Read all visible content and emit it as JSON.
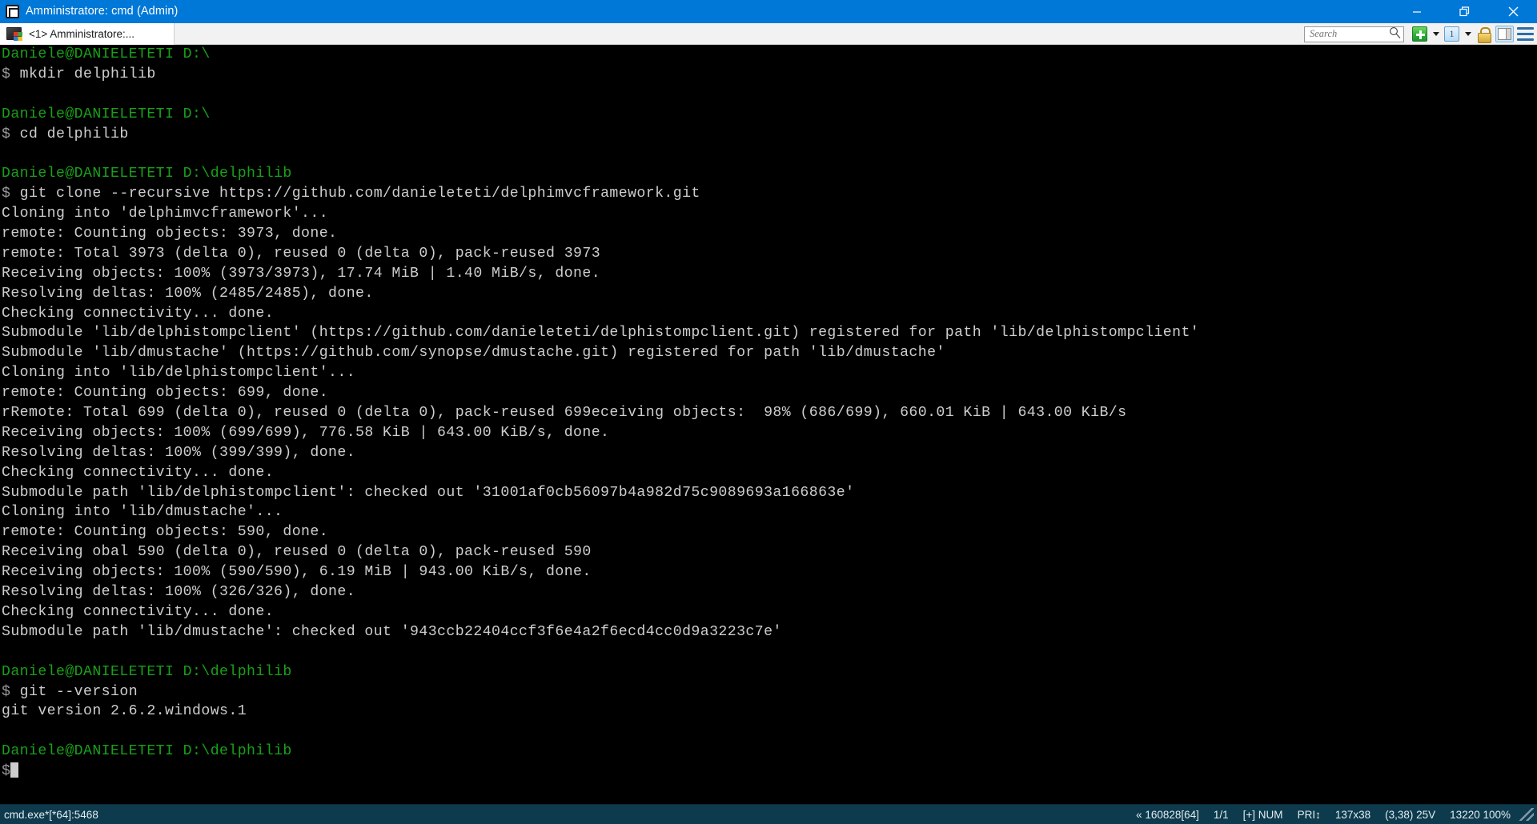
{
  "window": {
    "title": "Amministratore: cmd (Admin)",
    "icon": "console-window-icon",
    "minimize_label": "Minimize",
    "restore_label": "Restore",
    "close_label": "Close"
  },
  "tabbar": {
    "tabs": [
      {
        "label": "<1> Amministratore:...",
        "icon": "console-tab-icon",
        "active": true
      }
    ]
  },
  "toolbar": {
    "search": {
      "placeholder": "Search",
      "value": ""
    },
    "search_icon": "magnifier-icon",
    "new_console_label": "New console",
    "new_console_icon": "green-plus-icon",
    "new_console_caret": "chevron-down-icon",
    "switch_console_label": "Switch console",
    "switch_console_icon": "console-1-icon",
    "switch_console_caret": "chevron-down-icon",
    "lock_label": "Lock",
    "lock_icon": "padlock-icon",
    "panes_label": "Toggle panes",
    "panes_icon": "split-panes-icon",
    "menu_label": "Menu",
    "menu_icon": "hamburger-menu-icon"
  },
  "colors": {
    "titlebar": "#0078d7",
    "prompt_green": "#18a018",
    "dollar_gray": "#9a9a9a",
    "output_gray": "#cdcdcd",
    "terminal_bg": "#000000",
    "statusbar_bg": "#0e3a4d"
  },
  "terminal": {
    "lines": [
      {
        "segments": [
          {
            "text": "Daniele@DANIELETETI D:\\",
            "color": "green"
          }
        ]
      },
      {
        "segments": [
          {
            "text": "$",
            "color": "dim"
          },
          {
            "text": " mkdir delphilib",
            "color": "white"
          }
        ]
      },
      {
        "segments": [
          {
            "text": "",
            "color": "white"
          }
        ]
      },
      {
        "segments": [
          {
            "text": "Daniele@DANIELETETI D:\\",
            "color": "green"
          }
        ]
      },
      {
        "segments": [
          {
            "text": "$",
            "color": "dim"
          },
          {
            "text": " cd delphilib",
            "color": "white"
          }
        ]
      },
      {
        "segments": [
          {
            "text": "",
            "color": "white"
          }
        ]
      },
      {
        "segments": [
          {
            "text": "Daniele@DANIELETETI D:\\delphilib",
            "color": "green"
          }
        ]
      },
      {
        "segments": [
          {
            "text": "$",
            "color": "dim"
          },
          {
            "text": " git clone --recursive https://github.com/danieleteti/delphimvcframework.git",
            "color": "white"
          }
        ]
      },
      {
        "segments": [
          {
            "text": "Cloning into 'delphimvcframework'...",
            "color": "white"
          }
        ]
      },
      {
        "segments": [
          {
            "text": "remote: Counting objects: 3973, done.",
            "color": "white"
          }
        ]
      },
      {
        "segments": [
          {
            "text": "remote: Total 3973 (delta 0), reused 0 (delta 0), pack-reused 3973",
            "color": "white"
          }
        ]
      },
      {
        "segments": [
          {
            "text": "Receiving objects: 100% (3973/3973), 17.74 MiB | 1.40 MiB/s, done.",
            "color": "white"
          }
        ]
      },
      {
        "segments": [
          {
            "text": "Resolving deltas: 100% (2485/2485), done.",
            "color": "white"
          }
        ]
      },
      {
        "segments": [
          {
            "text": "Checking connectivity... done.",
            "color": "white"
          }
        ]
      },
      {
        "segments": [
          {
            "text": "Submodule 'lib/delphistompclient' (https://github.com/danieleteti/delphistompclient.git) registered for path 'lib/delphistompclient'",
            "color": "white"
          }
        ]
      },
      {
        "segments": [
          {
            "text": "Submodule 'lib/dmustache' (https://github.com/synopse/dmustache.git) registered for path 'lib/dmustache'",
            "color": "white"
          }
        ]
      },
      {
        "segments": [
          {
            "text": "Cloning into 'lib/delphistompclient'...",
            "color": "white"
          }
        ]
      },
      {
        "segments": [
          {
            "text": "remote: Counting objects: 699, done.",
            "color": "white"
          }
        ]
      },
      {
        "segments": [
          {
            "text": "rRemote: Total 699 (delta 0), reused 0 (delta 0), pack-reused 699eceiving objects:  98% (686/699), 660.01 KiB | 643.00 KiB/s",
            "color": "white"
          }
        ]
      },
      {
        "segments": [
          {
            "text": "Receiving objects: 100% (699/699), 776.58 KiB | 643.00 KiB/s, done.",
            "color": "white"
          }
        ]
      },
      {
        "segments": [
          {
            "text": "Resolving deltas: 100% (399/399), done.",
            "color": "white"
          }
        ]
      },
      {
        "segments": [
          {
            "text": "Checking connectivity... done.",
            "color": "white"
          }
        ]
      },
      {
        "segments": [
          {
            "text": "Submodule path 'lib/delphistompclient': checked out '31001af0cb56097b4a982d75c9089693a166863e'",
            "color": "white"
          }
        ]
      },
      {
        "segments": [
          {
            "text": "Cloning into 'lib/dmustache'...",
            "color": "white"
          }
        ]
      },
      {
        "segments": [
          {
            "text": "remote: Counting objects: 590, done.",
            "color": "white"
          }
        ]
      },
      {
        "segments": [
          {
            "text": "Receiving obal 590 (delta 0), reused 0 (delta 0), pack-reused 590",
            "color": "white"
          }
        ]
      },
      {
        "segments": [
          {
            "text": "Receiving objects: 100% (590/590), 6.19 MiB | 943.00 KiB/s, done.",
            "color": "white"
          }
        ]
      },
      {
        "segments": [
          {
            "text": "Resolving deltas: 100% (326/326), done.",
            "color": "white"
          }
        ]
      },
      {
        "segments": [
          {
            "text": "Checking connectivity... done.",
            "color": "white"
          }
        ]
      },
      {
        "segments": [
          {
            "text": "Submodule path 'lib/dmustache': checked out '943ccb22404ccf3f6e4a2f6ecd4cc0d9a3223c7e'",
            "color": "white"
          }
        ]
      },
      {
        "segments": [
          {
            "text": "",
            "color": "white"
          }
        ]
      },
      {
        "segments": [
          {
            "text": "Daniele@DANIELETETI D:\\delphilib",
            "color": "green"
          }
        ]
      },
      {
        "segments": [
          {
            "text": "$",
            "color": "dim"
          },
          {
            "text": " git --version",
            "color": "white"
          }
        ]
      },
      {
        "segments": [
          {
            "text": "git version 2.6.2.windows.1",
            "color": "white"
          }
        ]
      },
      {
        "segments": [
          {
            "text": "",
            "color": "white"
          }
        ]
      },
      {
        "segments": [
          {
            "text": "Daniele@DANIELETETI D:\\delphilib",
            "color": "green"
          }
        ]
      },
      {
        "segments": [
          {
            "text": "$",
            "color": "dim"
          }
        ],
        "cursor": true
      }
    ]
  },
  "statusbar": {
    "process": "cmd.exe*[*64]:5468",
    "items": [
      "« 160828[64]",
      "1/1",
      "[+] NUM",
      "PRI↕",
      "137x38",
      "(3,38) 25V",
      "13220 100%"
    ]
  }
}
